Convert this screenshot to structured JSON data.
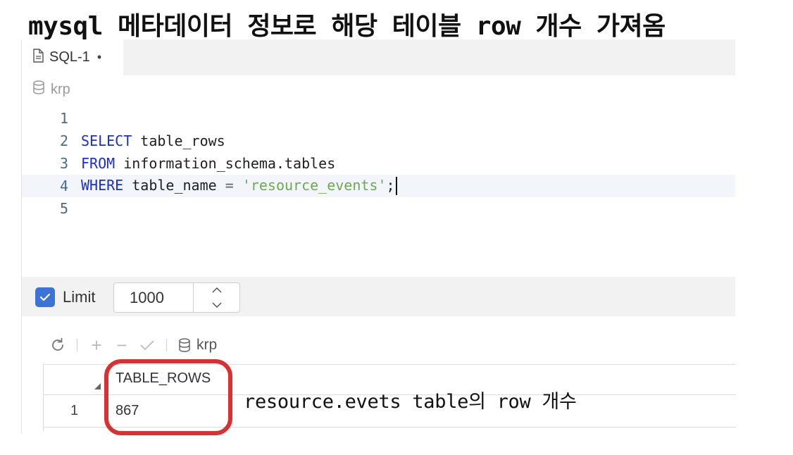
{
  "annotation": {
    "title": "mysql 메타데이터 정보로 해당 테이블 row 개수 가져옴",
    "note": "resource.evets table의 row 개수",
    "highlight_color": "#d93131"
  },
  "tab": {
    "label": "SQL-1",
    "modified_marker": "•",
    "icon": "file-icon"
  },
  "schema": {
    "name": "krp",
    "icon": "database-icon"
  },
  "editor": {
    "lines": [
      {
        "num": "1"
      },
      {
        "num": "2",
        "kw": "SELECT",
        "rest": " table_rows"
      },
      {
        "num": "3",
        "kw": "FROM",
        "rest": " information_schema.tables"
      },
      {
        "num": "4",
        "kw": "WHERE",
        "rest": " table_name ",
        "op": "=",
        "str": "'resource_events'",
        "end": ";"
      },
      {
        "num": "5"
      }
    ],
    "active_line": 4,
    "keyword_color": "#1a2fd1",
    "string_color": "#6fa84f"
  },
  "limit": {
    "checked": true,
    "label": "Limit",
    "value": "1000"
  },
  "results_toolbar": {
    "icons": [
      "refresh-icon",
      "add-row-icon",
      "remove-row-icon",
      "commit-icon",
      "database-icon"
    ],
    "add": "+",
    "remove": "−",
    "schema": "krp"
  },
  "results": {
    "columns": [
      "TABLE_ROWS"
    ],
    "rows": [
      {
        "num": "1",
        "values": [
          "867"
        ]
      }
    ]
  }
}
